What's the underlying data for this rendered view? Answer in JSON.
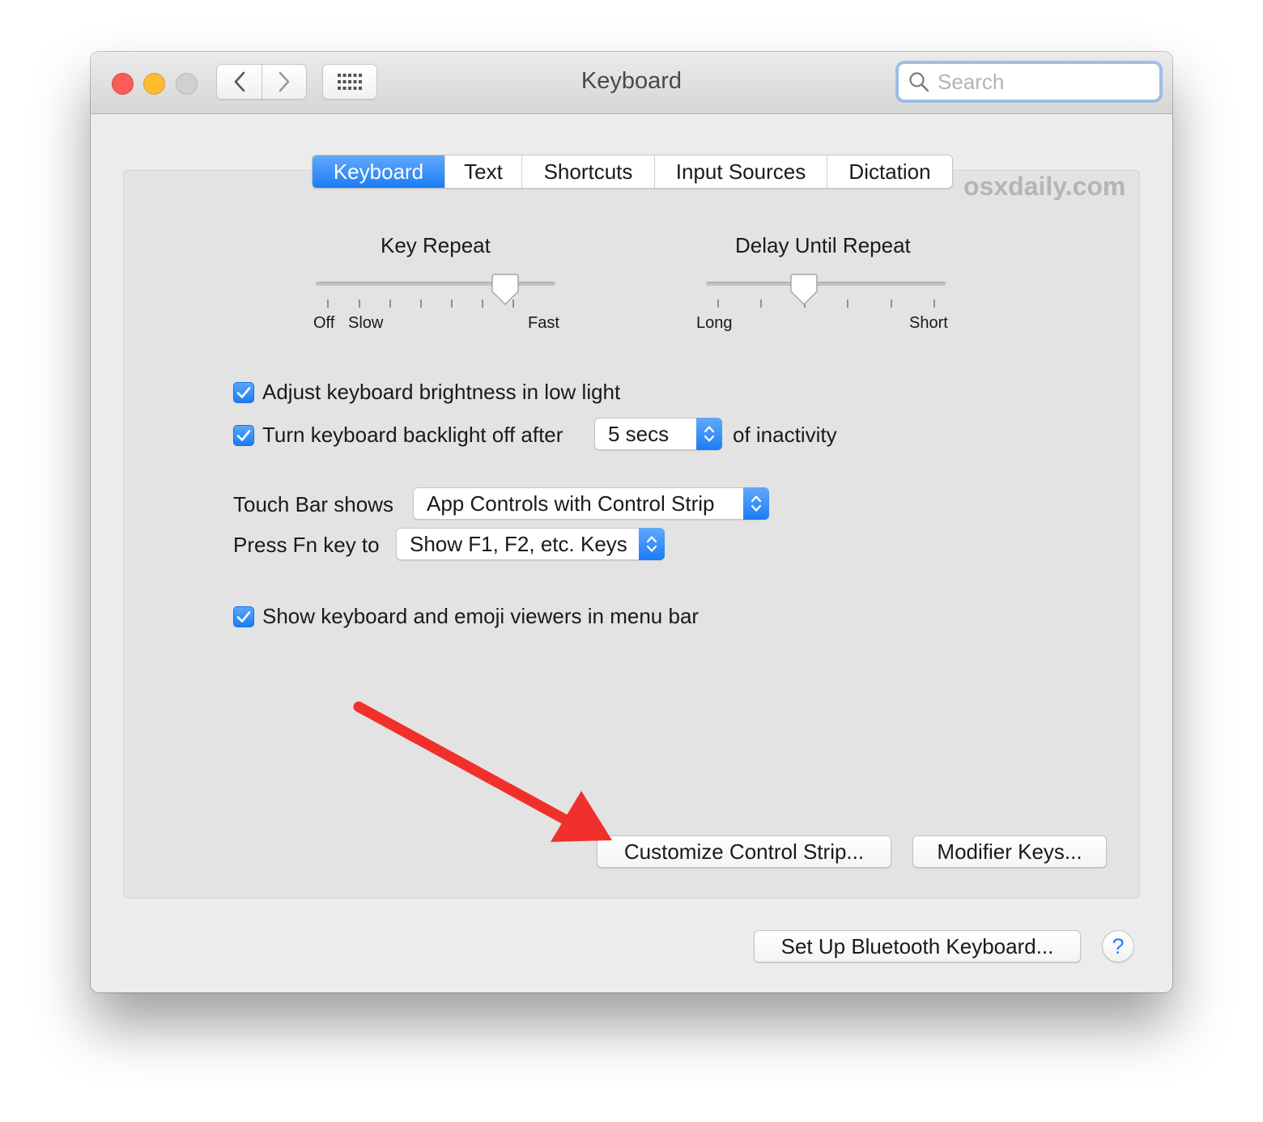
{
  "window": {
    "title": "Keyboard"
  },
  "search": {
    "placeholder": "Search"
  },
  "tabs": [
    {
      "label": "Keyboard",
      "active": true
    },
    {
      "label": "Text",
      "active": false
    },
    {
      "label": "Shortcuts",
      "active": false
    },
    {
      "label": "Input Sources",
      "active": false
    },
    {
      "label": "Dictation",
      "active": false
    }
  ],
  "watermark": "osxdaily.com",
  "key_repeat": {
    "title": "Key Repeat",
    "label_off": "Off",
    "label_slow": "Slow",
    "label_fast": "Fast",
    "level": 0.82
  },
  "delay_until_repeat": {
    "title": "Delay Until Repeat",
    "label_long": "Long",
    "label_short": "Short",
    "level": 0.4
  },
  "options": {
    "adjust_brightness": {
      "label": "Adjust keyboard brightness in low light",
      "checked": true
    },
    "backlight_off": {
      "label": "Turn keyboard backlight off after",
      "checked": true,
      "value": "5 secs",
      "suffix": "of inactivity"
    },
    "touch_bar": {
      "label": "Touch Bar shows",
      "value": "App Controls with Control Strip"
    },
    "fn_key": {
      "label": "Press Fn key to",
      "value": "Show F1, F2, etc. Keys"
    },
    "show_viewers": {
      "label": "Show keyboard and emoji viewers in menu bar",
      "checked": true
    }
  },
  "buttons": {
    "customize": "Customize Control Strip...",
    "modifier": "Modifier Keys...",
    "bluetooth": "Set Up Bluetooth Keyboard...",
    "help": "?"
  },
  "colors": {
    "accent": "#1b7cf5",
    "annotation_arrow": "#f2302b"
  }
}
